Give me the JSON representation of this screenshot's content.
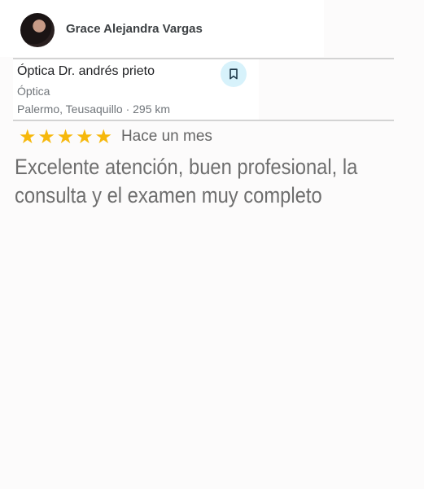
{
  "reviewer": {
    "name": "Grace Alejandra Vargas"
  },
  "place": {
    "name": "Óptica Dr. andrés prieto",
    "category": "Óptica",
    "location": "Palermo, Teusaquillo · 295 km",
    "save_icon": "bookmark-icon"
  },
  "review": {
    "stars": 5,
    "time": "Hace un mes",
    "text": "Excelente atención, buen profesional, la consulta y el examen muy completo"
  },
  "colors": {
    "star": "#f6b80c",
    "save_button_bg": "#d7f2fb",
    "secondary_text": "#70757a"
  }
}
